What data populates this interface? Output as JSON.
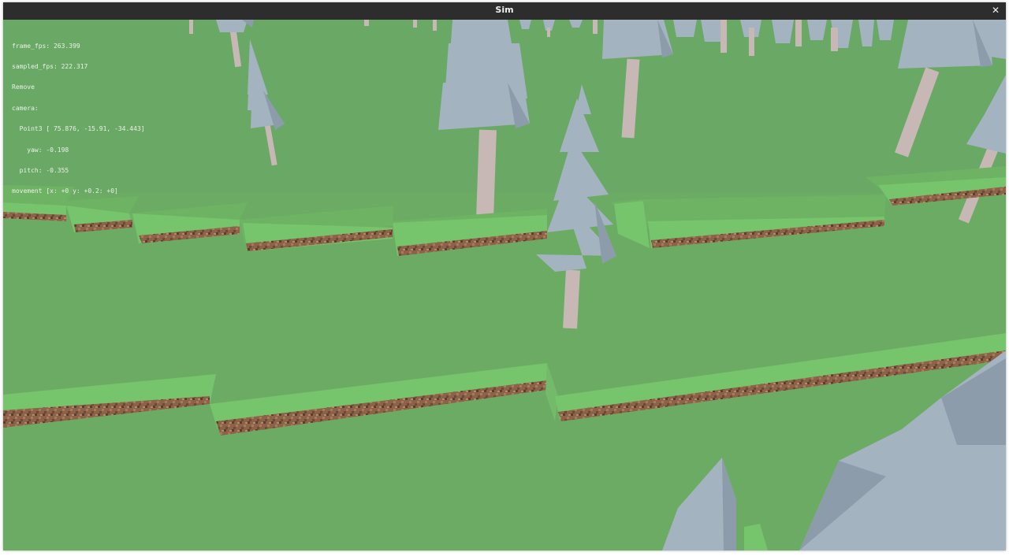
{
  "window": {
    "title": "Sim",
    "close_icon": "close-icon"
  },
  "hud": {
    "frame_fps": "frame_fps: 263.399",
    "sampled_fps": "sampled_fps: 222.317",
    "mode": "Remove",
    "camera_label": "camera:",
    "point": "  Point3 [ 75.876, -15.91, -34.443]",
    "yaw": "    yaw: -0.198",
    "pitch": "  pitch: -0.355",
    "movement": "movement [x: +0 y: +0.2: +0]"
  },
  "colors": {
    "grass_top": "#6cab63",
    "grass_side": "#76c46b",
    "dirt": "#8c6248",
    "foliage": "#a4b3c0",
    "trunk": "#c7b8b5",
    "titlebar": "#2d2d2d"
  }
}
